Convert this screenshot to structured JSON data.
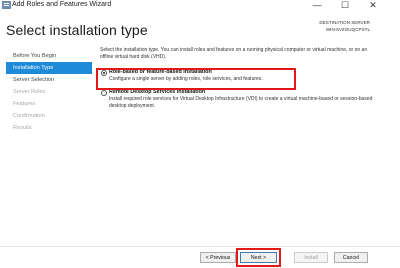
{
  "window": {
    "title": "Add Roles and Features Wizard",
    "controls": {
      "minimize": "—",
      "maximize": "☐",
      "close": "✕"
    }
  },
  "heading": "Select installation type",
  "destination": {
    "label": "DESTINATION SERVER",
    "server": "WIN-5VZOUQCPSTL"
  },
  "nav": [
    {
      "label": "Before You Begin",
      "state": "normal"
    },
    {
      "label": "Installation Type",
      "state": "active"
    },
    {
      "label": "Server Selection",
      "state": "normal"
    },
    {
      "label": "Server Roles",
      "state": "disabled"
    },
    {
      "label": "Features",
      "state": "disabled"
    },
    {
      "label": "Confirmation",
      "state": "disabled"
    },
    {
      "label": "Results",
      "state": "disabled"
    }
  ],
  "content": {
    "description": "Select the installation type. You can install roles and features on a running physical computer or virtual machine, or on an offline virtual hard disk (VHD).",
    "options": [
      {
        "title": "Role-based or feature-based installation",
        "desc": "Configure a single server by adding roles, role services, and features.",
        "selected": true
      },
      {
        "title": "Remote Desktop Services installation",
        "desc": "Install required role services for Virtual Desktop Infrastructure (VDI) to create a virtual machine-based or session-based desktop deployment.",
        "selected": false
      }
    ]
  },
  "buttons": {
    "previous": "< Previous",
    "next": "Next >",
    "install": "Install",
    "cancel": "Cancel"
  },
  "colors": {
    "accent": "#1e8bd8",
    "highlight": "#e31919"
  }
}
